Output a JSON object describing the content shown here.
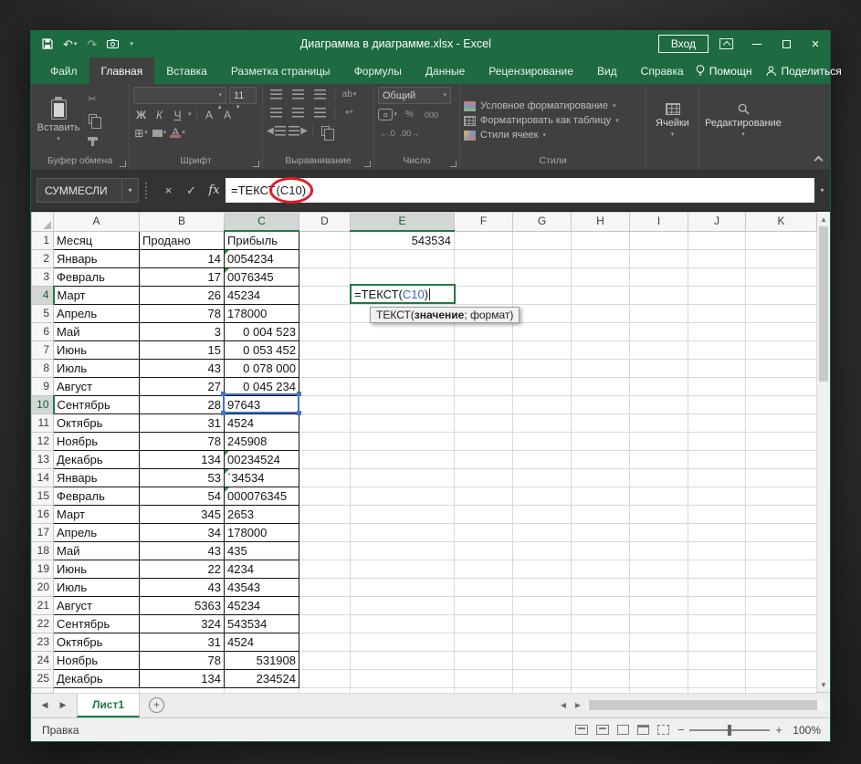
{
  "colors": {
    "chrome_green": "#1e6b41",
    "accent_green": "#217346",
    "annotation_red": "#dd1d28",
    "reference_blue": "#4472c4"
  },
  "titlebar": {
    "title": "Диаграмма в диаграмме.xlsx  -  Excel",
    "signin_label": "Вход"
  },
  "tabs": [
    "Файл",
    "Главная",
    "Вставка",
    "Разметка страницы",
    "Формулы",
    "Данные",
    "Рецензирование",
    "Вид",
    "Справка"
  ],
  "active_tab": "Главная",
  "tab_extras": {
    "assistant": "Помощн",
    "share": "Поделиться"
  },
  "ribbon": {
    "paste_label": "Вставить",
    "group_labels": {
      "clipboard": "Буфер обмена",
      "font": "Шрифт",
      "alignment": "Выравнивание",
      "number": "Число",
      "styles": "Стили"
    },
    "font_size": "11",
    "bold": "Ж",
    "italic": "К",
    "underline": "Ч",
    "number_format": "Общий",
    "percent": "%",
    "thousands": "000",
    "dec_inc": "←.0",
    "dec_dec": ".00→",
    "styles_items": [
      "Условное форматирование",
      "Форматировать как таблицу",
      "Стили ячеек"
    ],
    "cells_label": "Ячейки",
    "editing_label": "Редактирование"
  },
  "glyphs": {
    "dropdown": "▾",
    "cancel": "×",
    "enter": "✓",
    "fx": "fx",
    "cut": "✂",
    "undo": "↶",
    "redo": "↷",
    "borders": "⊞",
    "left": "◀",
    "right": "▶",
    "up": "▲",
    "down": "▼",
    "plus": "+",
    "minus": "−",
    "currency": "¤",
    "wrap": "↩",
    "ab": "ab"
  },
  "formula_bar": {
    "name_box": "СУММЕСЛИ",
    "formula_pre": "=ТЕКСТ",
    "formula_ref": "(C10)"
  },
  "edit": {
    "pre": "=ТЕКСТ(",
    "ref": "C10",
    "post": ")",
    "tooltip_pre": "ТЕКСТ(",
    "tooltip_bold": "значение",
    "tooltip_post": "; формат)"
  },
  "grid": {
    "columns": [
      "A",
      "B",
      "C",
      "D",
      "E",
      "F",
      "G",
      "H",
      "I",
      "J",
      "K"
    ],
    "selection": {
      "columns": [
        "C",
        "E"
      ],
      "rows": [
        "4",
        "10"
      ]
    },
    "rows": [
      {
        "n": "1",
        "a": "Месяц",
        "b": "Продано",
        "c": "Прибыль",
        "e": "543534",
        "b_al": "left",
        "c_al": "left"
      },
      {
        "n": "2",
        "a": "Январь",
        "b": "14",
        "c": "0054234",
        "flag": true
      },
      {
        "n": "3",
        "a": "Февраль",
        "b": "17",
        "c": "0076345",
        "flag": true
      },
      {
        "n": "4",
        "a": "Март",
        "b": "26",
        "c": "45234"
      },
      {
        "n": "5",
        "a": "Апрель",
        "b": "78",
        "c": "178000"
      },
      {
        "n": "6",
        "a": "Май",
        "b": "3",
        "c": "0 004 523",
        "c_al": "right"
      },
      {
        "n": "7",
        "a": "Июнь",
        "b": "15",
        "c": "0 053 452",
        "c_al": "right"
      },
      {
        "n": "8",
        "a": "Июль",
        "b": "43",
        "c": "0 078 000",
        "c_al": "right"
      },
      {
        "n": "9",
        "a": "Август",
        "b": "27",
        "c": "0 045 234",
        "c_al": "right"
      },
      {
        "n": "10",
        "a": "Сентябрь",
        "b": "28",
        "c": "97643"
      },
      {
        "n": "11",
        "a": "Октябрь",
        "b": "31",
        "c": "4524"
      },
      {
        "n": "12",
        "a": "Ноябрь",
        "b": "78",
        "c": "245908"
      },
      {
        "n": "13",
        "a": "Декабрь",
        "b": "134",
        "c": "00234524",
        "flag": true
      },
      {
        "n": "14",
        "a": "Январь",
        "b": "53",
        "c": "`34534",
        "flag": true
      },
      {
        "n": "15",
        "a": "Февраль",
        "b": "54",
        "c": "000076345",
        "flag": true
      },
      {
        "n": "16",
        "a": "Март",
        "b": "345",
        "c": "2653"
      },
      {
        "n": "17",
        "a": "Апрель",
        "b": "34",
        "c": "178000"
      },
      {
        "n": "18",
        "a": "Май",
        "b": "43",
        "c": "435"
      },
      {
        "n": "19",
        "a": "Июнь",
        "b": "22",
        "c": "4234"
      },
      {
        "n": "20",
        "a": "Июль",
        "b": "43",
        "c": "43543"
      },
      {
        "n": "21",
        "a": "Август",
        "b": "5363",
        "c": "45234"
      },
      {
        "n": "22",
        "a": "Сентябрь",
        "b": "324",
        "c": "543534"
      },
      {
        "n": "23",
        "a": "Октябрь",
        "b": "31",
        "c": "4524"
      },
      {
        "n": "24",
        "a": "Ноябрь",
        "b": "78",
        "c": "531908",
        "c_al": "right"
      },
      {
        "n": "25",
        "a": "Декабрь",
        "b": "134",
        "c": "234524",
        "c_al": "right"
      }
    ]
  },
  "sheet_bar": {
    "active_tab": "Лист1",
    "add_label": "+"
  },
  "status_bar": {
    "mode": "Правка",
    "zoom": "100%"
  }
}
